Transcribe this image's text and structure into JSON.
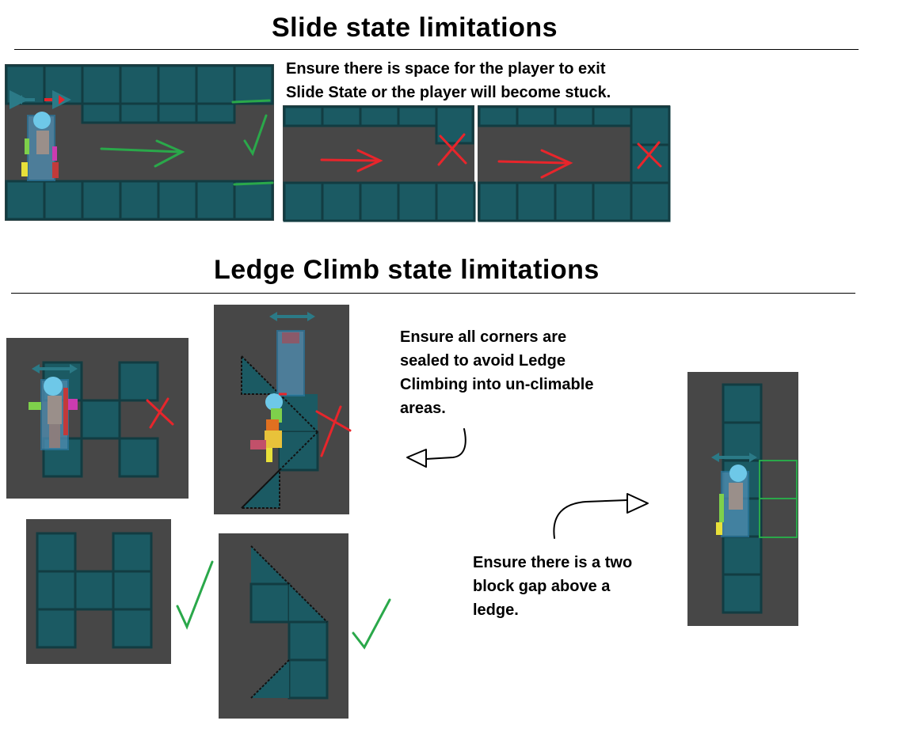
{
  "slide": {
    "title": "Slide state limitations",
    "note": "Ensure there is space for the player to exit\nSlide State or the player will become stuck."
  },
  "ledge": {
    "title": "Ledge Climb state limitations",
    "note_corners": "Ensure all corners are\nsealed to avoid Ledge\nClimbing into un-climable\nareas.",
    "note_gap": "Ensure there is a two\nblock gap above a\nledge."
  },
  "colors": {
    "background": "#ffffff",
    "panel": "#474747",
    "tile": "#1b5a63",
    "tile_border": "#123c42",
    "valid": "#2aa84a",
    "invalid": "#e8252b",
    "arrow_direction": "#2b7a87"
  }
}
